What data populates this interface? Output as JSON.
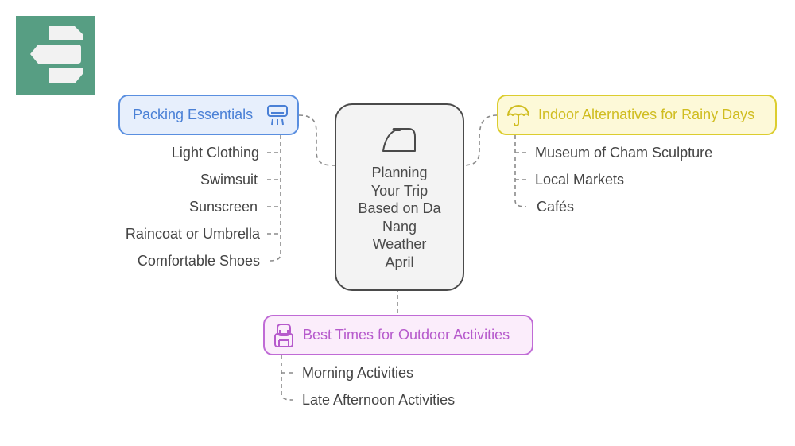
{
  "logo": {
    "icon": "directions-sign-icon",
    "color": "#579e83"
  },
  "center": {
    "title": "Planning Your Trip Based on Da Nang Weather April",
    "lines": [
      "Planning",
      "Your Trip",
      "Based on Da",
      "Nang",
      "Weather",
      "April"
    ],
    "icon": "iron-icon"
  },
  "branches": {
    "packing": {
      "label": "Packing Essentials",
      "icon": "air-conditioner-icon",
      "color": "#4a80d6",
      "items": [
        "Light Clothing",
        "Swimsuit",
        "Sunscreen",
        "Raincoat or Umbrella",
        "Comfortable Shoes"
      ]
    },
    "indoor": {
      "label": "Indoor Alternatives for Rainy Days",
      "icon": "umbrella-icon",
      "color": "#d0bd20",
      "items": [
        "Museum of Cham Sculpture",
        "Local Markets",
        "Cafés"
      ]
    },
    "outdoor": {
      "label": "Best Times for Outdoor Activities",
      "icon": "backpack-icon",
      "color": "#b65acc",
      "items": [
        "Morning Activities",
        "Late Afternoon Activities"
      ]
    }
  }
}
